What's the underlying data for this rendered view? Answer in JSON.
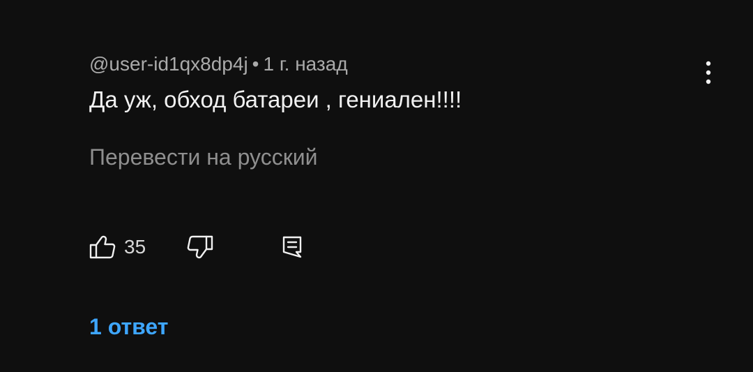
{
  "comment": {
    "author": "@user-id1qx8dp4j",
    "separator": "•",
    "time": "1 г. назад",
    "text": "Да уж, обход батареи , гениален!!!!",
    "translate_label": "Перевести на русский",
    "like_count": "35",
    "replies_label": "1 ответ"
  },
  "icons": {
    "like": "thumbs-up-icon",
    "dislike": "thumbs-down-icon",
    "reply": "comment-reply-icon",
    "menu": "more-vertical-icon"
  },
  "colors": {
    "background": "#0f0f0f",
    "text": "#f1f1f1",
    "meta": "#aaaaaa",
    "link": "#3ea6ff"
  }
}
